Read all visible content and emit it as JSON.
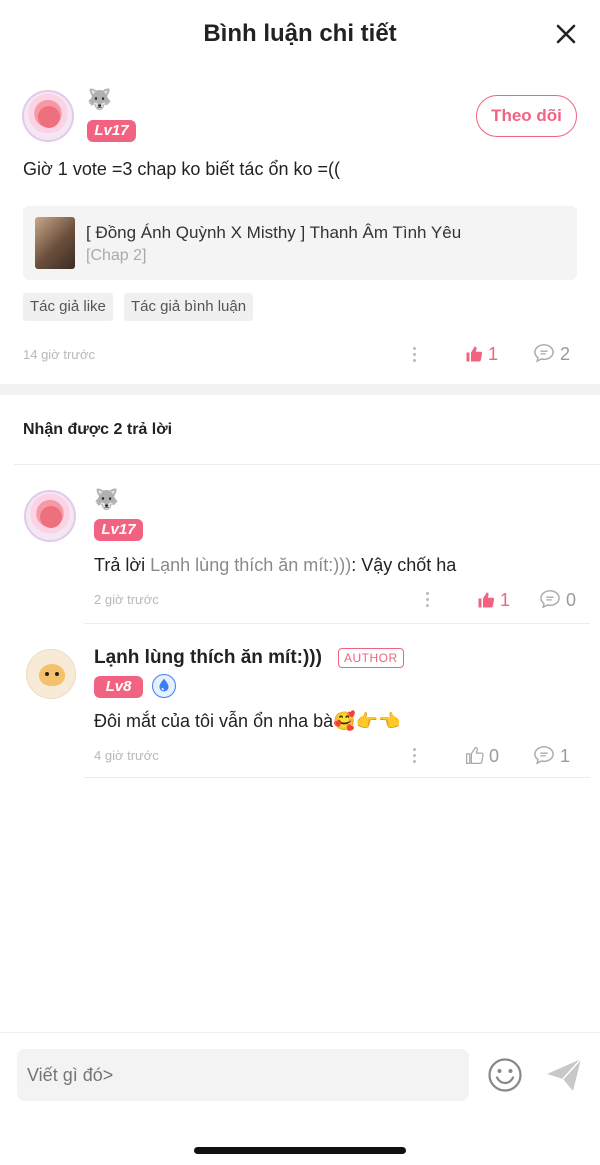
{
  "header": {
    "title": "Bình luận chi tiết",
    "close_icon": "close-icon"
  },
  "comment": {
    "level": "Lv17",
    "follow_label": "Theo dõi",
    "text": "Giờ 1 vote =3 chap ko biết tác ổn ko =((",
    "story": {
      "title": "[ Đồng Ánh Quỳnh X Misthy ] Thanh Âm Tình Yêu",
      "chapter": "[Chap 2]"
    },
    "tags": [
      "Tác giả like",
      "Tác giả bình luận"
    ],
    "time": "14 giờ trước",
    "likes": "1",
    "replies_count": "2"
  },
  "replies_header": "Nhận được 2 trả lời",
  "replies": [
    {
      "level": "Lv17",
      "prefix": "Trả lời ",
      "mention": "Lạnh lùng thích ăn mít:)))",
      "text": ": Vậy chốt ha",
      "time": "2 giờ trước",
      "likes": "1",
      "comments": "0"
    },
    {
      "name": "Lạnh lùng thích ăn mít:)))",
      "author_badge": "AUTHOR",
      "level": "Lv8",
      "text": "Đôi mắt của tôi vẫn ổn nha bà🥰👉👈",
      "time": "4 giờ trước",
      "likes": "0",
      "comments": "1"
    }
  ],
  "composer": {
    "placeholder": "Viết gì đó>"
  },
  "colors": {
    "accent": "#f26381",
    "muted": "#999999",
    "badge_blue": "#3d7ef3"
  }
}
